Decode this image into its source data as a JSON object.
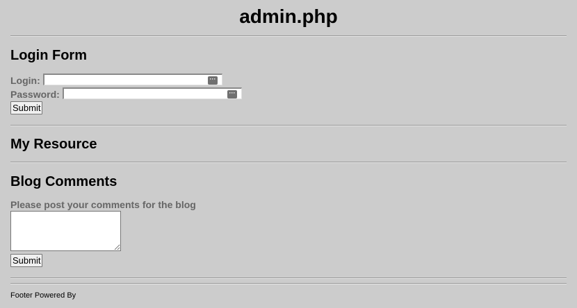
{
  "page": {
    "title": "admin.php"
  },
  "login": {
    "heading": "Login Form",
    "login_label": "Login:",
    "login_value": "",
    "password_label": "Password:",
    "password_value": "",
    "submit_label": "Submit",
    "field_icon": "password-manager-icon"
  },
  "resource": {
    "heading": "My Resource"
  },
  "blog": {
    "heading": "Blog Comments",
    "prompt": "Please post your comments for the blog",
    "comment_value": "",
    "submit_label": "Submit"
  },
  "footer": {
    "text": "Footer Powered By"
  },
  "colors": {
    "background": "#cccccc",
    "label_text": "#666666",
    "heading_text": "#000000"
  }
}
